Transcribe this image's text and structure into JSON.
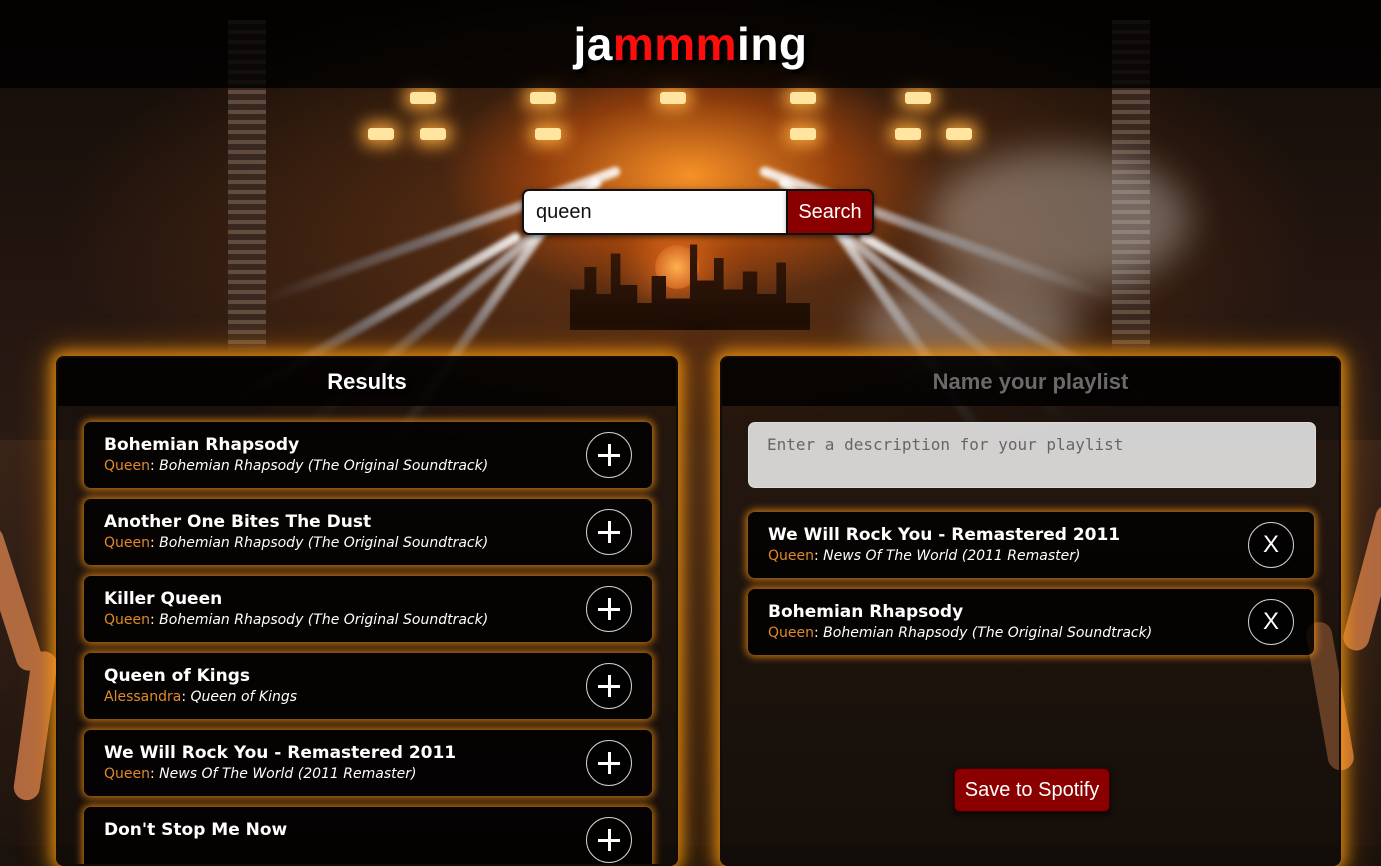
{
  "app": {
    "logo_part1": "ja",
    "logo_part2": "mmm",
    "logo_part3": "ing"
  },
  "search": {
    "value": "queen",
    "button_label": "Search"
  },
  "results": {
    "title": "Results",
    "tracks": [
      {
        "name": "Bohemian Rhapsody",
        "artist": "Queen",
        "album": "Bohemian Rhapsody (The Original Soundtrack)"
      },
      {
        "name": "Another One Bites The Dust",
        "artist": "Queen",
        "album": "Bohemian Rhapsody (The Original Soundtrack)"
      },
      {
        "name": "Killer Queen",
        "artist": "Queen",
        "album": "Bohemian Rhapsody (The Original Soundtrack)"
      },
      {
        "name": "Queen of Kings",
        "artist": "Alessandra",
        "album": "Queen of Kings"
      },
      {
        "name": "We Will Rock You - Remastered 2011",
        "artist": "Queen",
        "album": "News Of The World (2011 Remaster)"
      },
      {
        "name": "Don't Stop Me Now",
        "artist": "",
        "album": ""
      }
    ],
    "add_label": "+"
  },
  "playlist": {
    "name_placeholder": "Name your playlist",
    "description_placeholder": "Enter a description for your playlist",
    "tracks": [
      {
        "name": "We Will Rock You - Remastered 2011",
        "artist": "Queen",
        "album": "News Of The World (2011 Remaster)"
      },
      {
        "name": "Bohemian Rhapsody",
        "artist": "Queen",
        "album": "Bohemian Rhapsody (The Original Soundtrack)"
      }
    ],
    "remove_label": "X",
    "save_label": "Save to Spotify"
  },
  "colors": {
    "accent_red": "#8a0000",
    "logo_red": "#ff0d0d",
    "artist_orange": "#e08a2a",
    "glow": "#ffa014"
  },
  "icons": {
    "add": "plus-icon",
    "remove": "x-icon"
  }
}
